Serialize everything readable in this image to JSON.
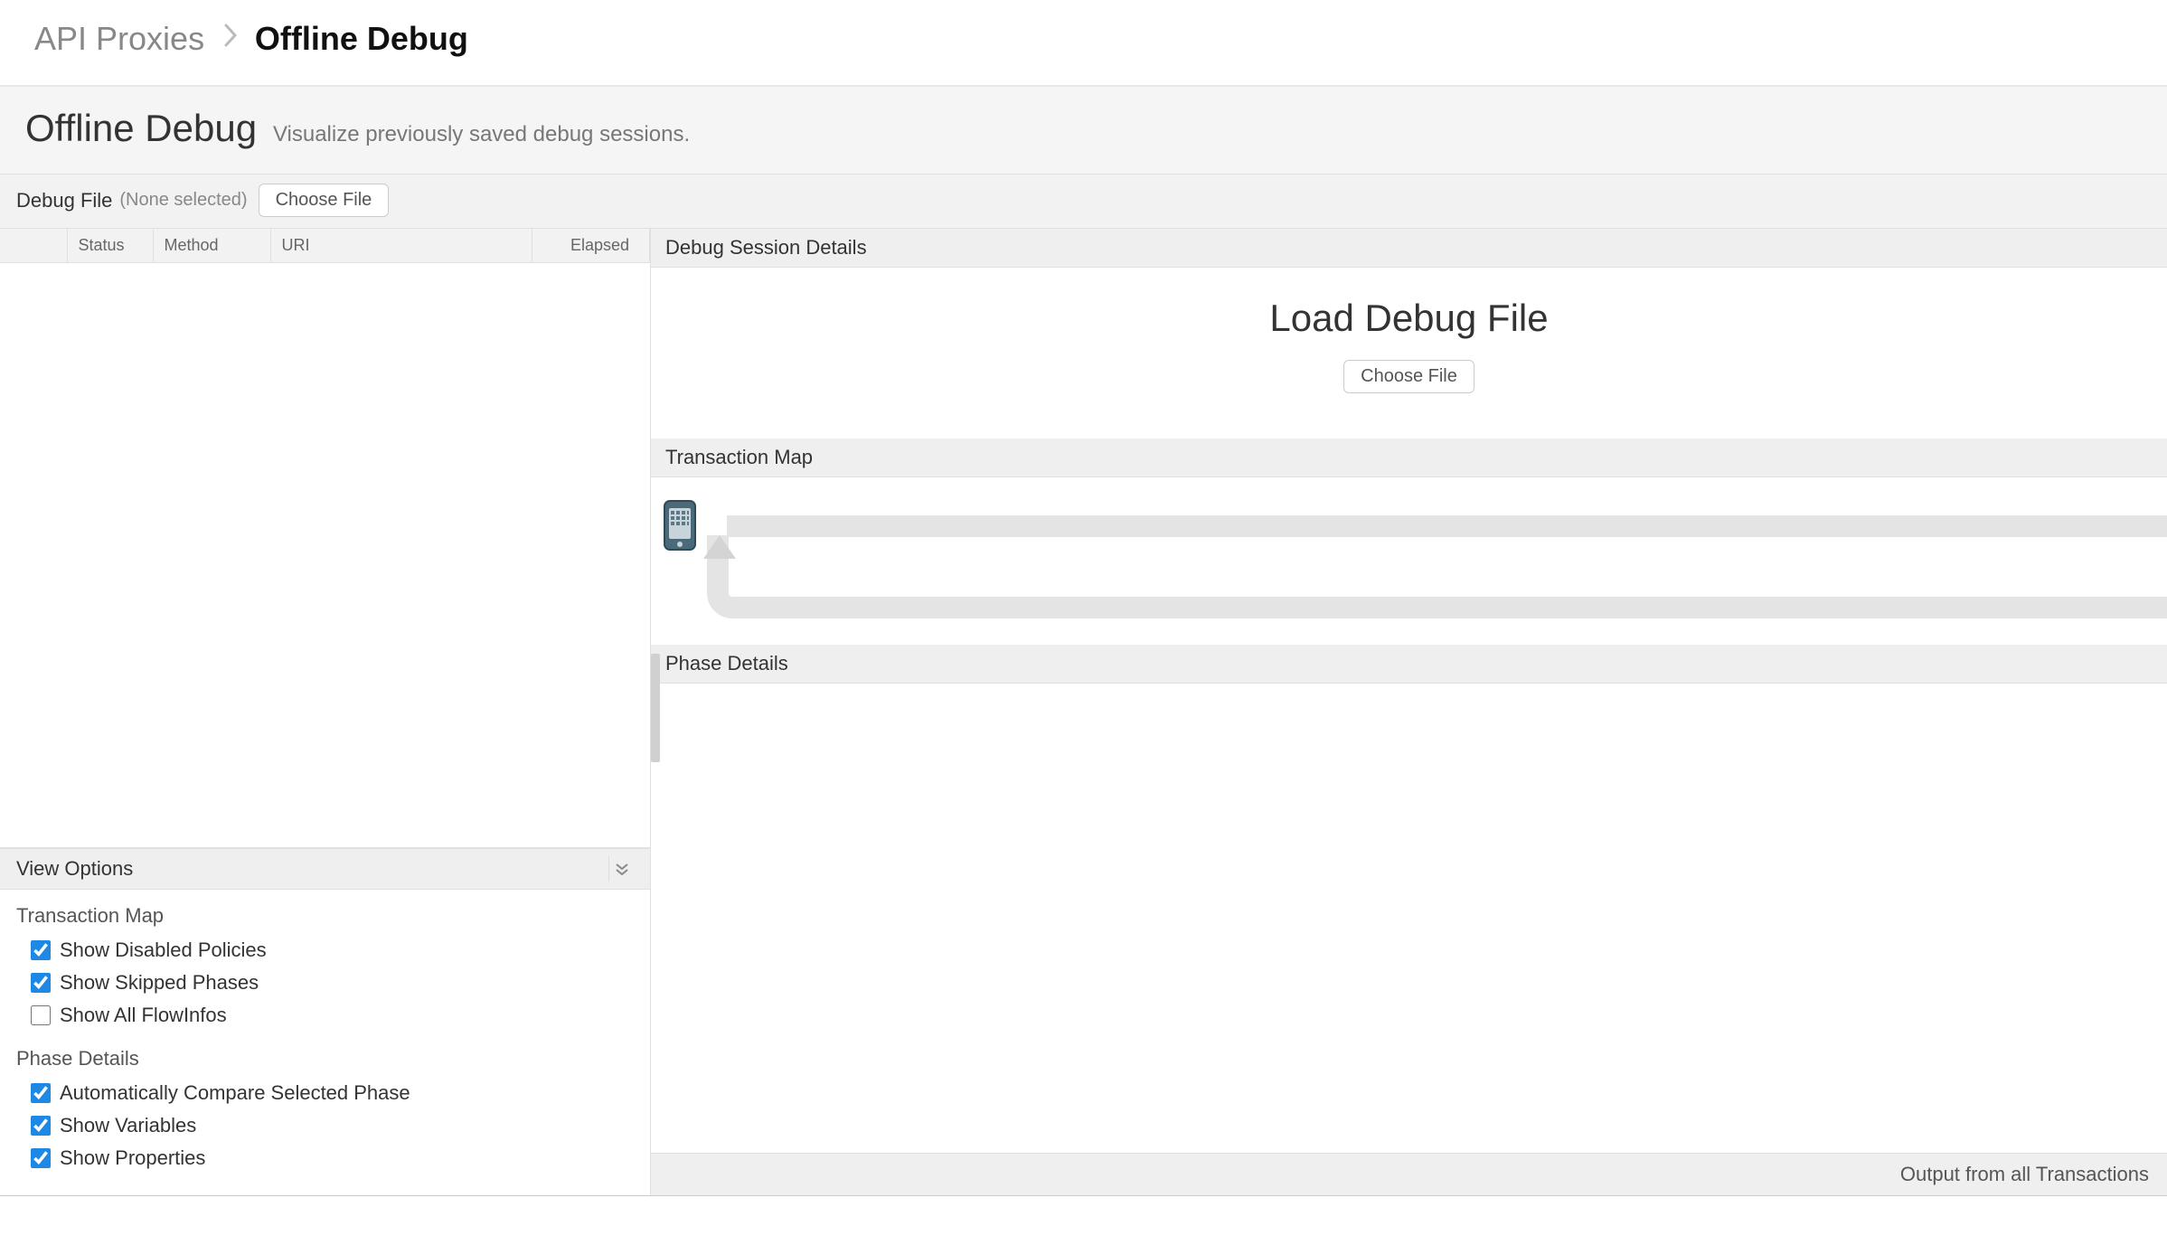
{
  "breadcrumb": {
    "parent": "API Proxies",
    "current": "Offline Debug"
  },
  "header": {
    "title": "Offline Debug",
    "subtitle": "Visualize previously saved debug sessions."
  },
  "file_bar": {
    "label": "Debug File",
    "status": "(None selected)",
    "choose_label": "Choose File"
  },
  "table": {
    "columns": {
      "status": "Status",
      "method": "Method",
      "uri": "URI",
      "elapsed": "Elapsed"
    }
  },
  "view_options": {
    "title": "View Options",
    "transaction_map": {
      "title": "Transaction Map",
      "items": [
        {
          "label": "Show Disabled Policies",
          "checked": true
        },
        {
          "label": "Show Skipped Phases",
          "checked": true
        },
        {
          "label": "Show All FlowInfos",
          "checked": false
        }
      ]
    },
    "phase_details": {
      "title": "Phase Details",
      "items": [
        {
          "label": "Automatically Compare Selected Phase",
          "checked": true
        },
        {
          "label": "Show Variables",
          "checked": true
        },
        {
          "label": "Show Properties",
          "checked": true
        }
      ]
    }
  },
  "right": {
    "session_details_title": "Debug Session Details",
    "load_title": "Load Debug File",
    "choose_label": "Choose File",
    "transaction_map_title": "Transaction Map",
    "phase_details_title": "Phase Details",
    "footer": "Output from all Transactions"
  }
}
